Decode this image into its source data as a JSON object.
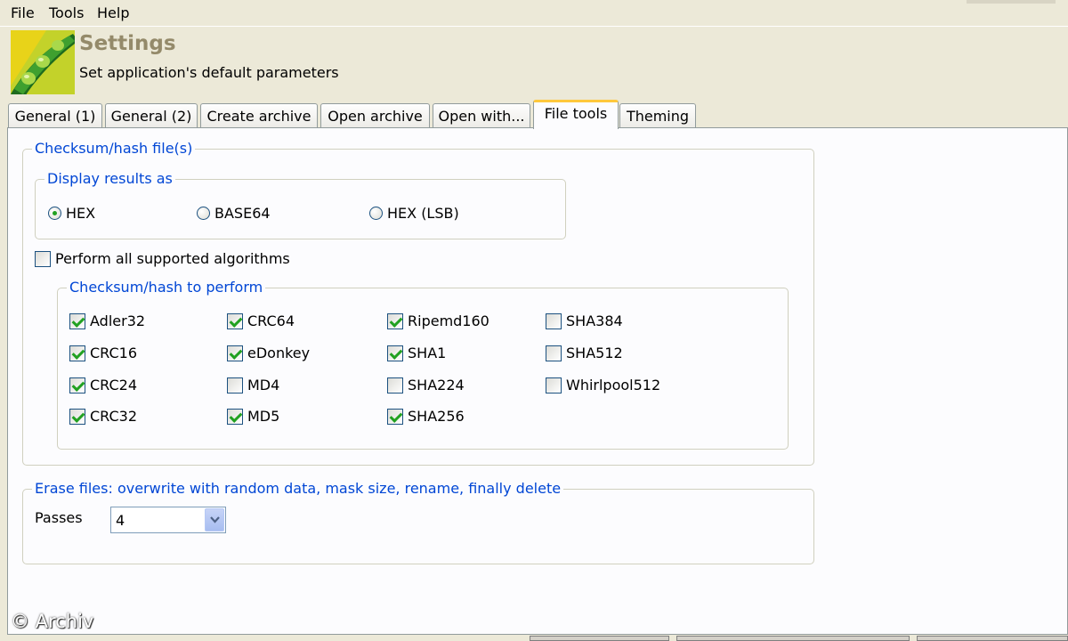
{
  "menu": {
    "file": "File",
    "tools": "Tools",
    "help": "Help"
  },
  "header": {
    "title": "Settings",
    "subtitle": "Set application's default parameters"
  },
  "tabs": [
    "General (1)",
    "General (2)",
    "Create archive",
    "Open archive",
    "Open with...",
    "File tools",
    "Theming"
  ],
  "active_tab": "File tools",
  "checksum_group": {
    "label": "Checksum/hash file(s)",
    "display_results": {
      "label": "Display results as",
      "options": [
        "HEX",
        "BASE64",
        "HEX (LSB)"
      ],
      "selected": "HEX"
    },
    "perform_all": {
      "label": "Perform all supported algorithms",
      "checked": false
    },
    "algorithms_group": {
      "label": "Checksum/hash to perform",
      "items": [
        {
          "label": "Adler32",
          "checked": true
        },
        {
          "label": "CRC16",
          "checked": true
        },
        {
          "label": "CRC24",
          "checked": true
        },
        {
          "label": "CRC32",
          "checked": true
        },
        {
          "label": "CRC64",
          "checked": true
        },
        {
          "label": "eDonkey",
          "checked": true
        },
        {
          "label": "MD4",
          "checked": false
        },
        {
          "label": "MD5",
          "checked": true
        },
        {
          "label": "Ripemd160",
          "checked": true
        },
        {
          "label": "SHA1",
          "checked": true
        },
        {
          "label": "SHA224",
          "checked": false
        },
        {
          "label": "SHA256",
          "checked": true
        },
        {
          "label": "SHA384",
          "checked": false
        },
        {
          "label": "SHA512",
          "checked": false
        },
        {
          "label": "Whirlpool512",
          "checked": false
        }
      ]
    }
  },
  "erase_group": {
    "label": "Erase files: overwrite with random data, mask size, rename, finally delete",
    "passes_label": "Passes",
    "passes_value": "4"
  },
  "watermark": "© Archiv",
  "icons": {
    "logo": "peazip-pea-pod-logo",
    "radio": "radio-icon",
    "checkbox": "checkbox-icon",
    "dropdown": "chevron-down-icon"
  },
  "colors": {
    "group_label": "#0046d5",
    "title": "#948a6a",
    "active_tab_accent": "#ffc83c",
    "check_mark": "#21a121"
  }
}
